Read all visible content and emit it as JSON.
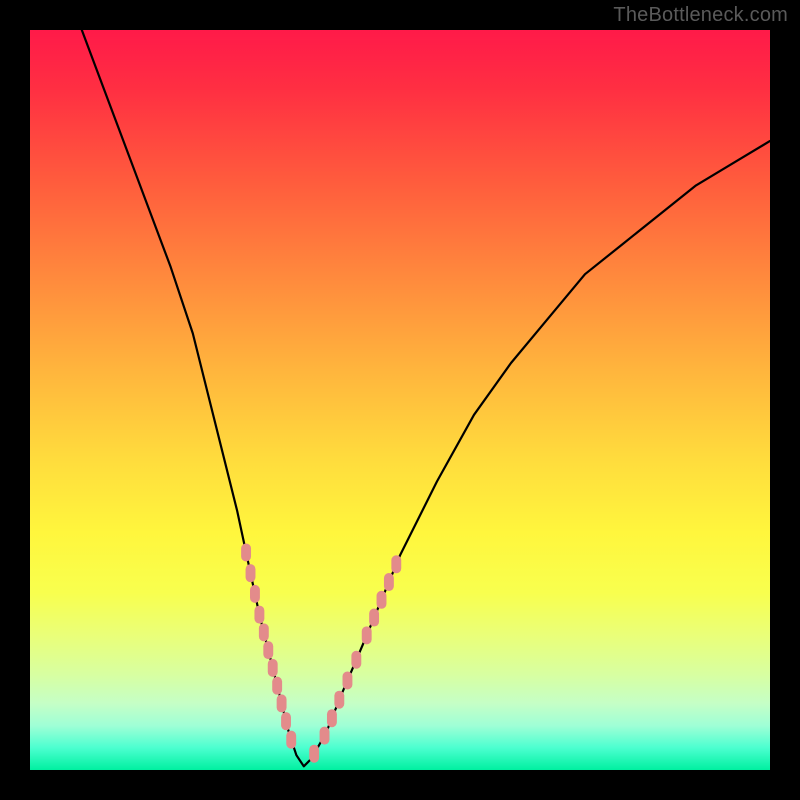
{
  "watermark": "TheBottleneck.com",
  "chart_data": {
    "type": "line",
    "title": "",
    "xlabel": "",
    "ylabel": "",
    "xlim": [
      0,
      100
    ],
    "ylim": [
      0,
      100
    ],
    "x": [
      7,
      10,
      13,
      16,
      19,
      22,
      24,
      26,
      28,
      29.5,
      31,
      32.5,
      34,
      35,
      36,
      37,
      38,
      40,
      42,
      45,
      50,
      55,
      60,
      65,
      70,
      75,
      80,
      85,
      90,
      95,
      100
    ],
    "values": [
      100,
      92,
      84,
      76,
      68,
      59,
      51,
      43,
      35,
      28,
      21,
      15,
      9,
      5,
      2,
      0.5,
      1.5,
      5,
      10,
      17,
      29,
      39,
      48,
      55,
      61,
      67,
      71,
      75,
      79,
      82,
      85
    ],
    "dotted_highlight_range_pct": {
      "y_min": 2,
      "y_max": 30
    },
    "dot_color": "#e38b8b",
    "line_color": "#000000",
    "dot_radius_px": 9
  },
  "colors": {
    "chart_bg_top": "#ff1a49",
    "chart_bg_bottom": "#00f0a0",
    "page_bg": "#000000",
    "watermark": "#5a5a5a"
  }
}
